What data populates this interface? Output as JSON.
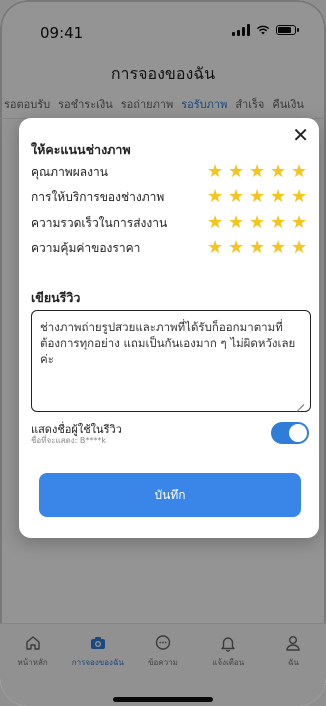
{
  "status": {
    "time": "09:41"
  },
  "page": {
    "title": "การจองของฉัน"
  },
  "tabs": [
    "รอตอบรับ",
    "รอชำระเงิน",
    "รอถ่ายภาพ",
    "รอรับภาพ",
    "สำเร็จ",
    "คืนเงิน"
  ],
  "active_tab": "รอรับภาพ",
  "modal": {
    "rating_title": "ให้คะแนนช่างภาพ",
    "ratings": [
      {
        "label": "คุณภาพผลงาน",
        "stars": 5
      },
      {
        "label": "การให้บริการของช่างภาพ",
        "stars": 5
      },
      {
        "label": "ความรวดเร็วในการส่งงาน",
        "stars": 5
      },
      {
        "label": "ความคุ้มค่าของราคา",
        "stars": 5
      }
    ],
    "review_title": "เขียนรีวิว",
    "review_text": "ช่างภาพถ่ายรูปสวยและภาพที่ได้รับก็ออกมาตามที่ต้องการทุกอย่าง แถมเป็นกันเองมาก ๆ ไม่ผิดหวังเลยค่ะ",
    "show_name_label": "แสดงชื่อผู้ใช้ในรีวิว",
    "display_name_hint": "ชื่อที่จะแสดง: B****k",
    "show_name_enabled": true,
    "save_label": "บันทึก",
    "close_icon": "close-icon"
  },
  "nav": [
    {
      "label": "หน้าหลัก",
      "icon": "home-icon"
    },
    {
      "label": "การจองของฉัน",
      "icon": "camera-icon",
      "active": true
    },
    {
      "label": "ข้อความ",
      "icon": "chat-icon"
    },
    {
      "label": "แจ้งเตือน",
      "icon": "bell-icon"
    },
    {
      "label": "ฉัน",
      "icon": "user-icon"
    }
  ],
  "colors": {
    "accent": "#2f7dd8",
    "star": "#f5c51e",
    "save_button": "#3a86e8"
  }
}
